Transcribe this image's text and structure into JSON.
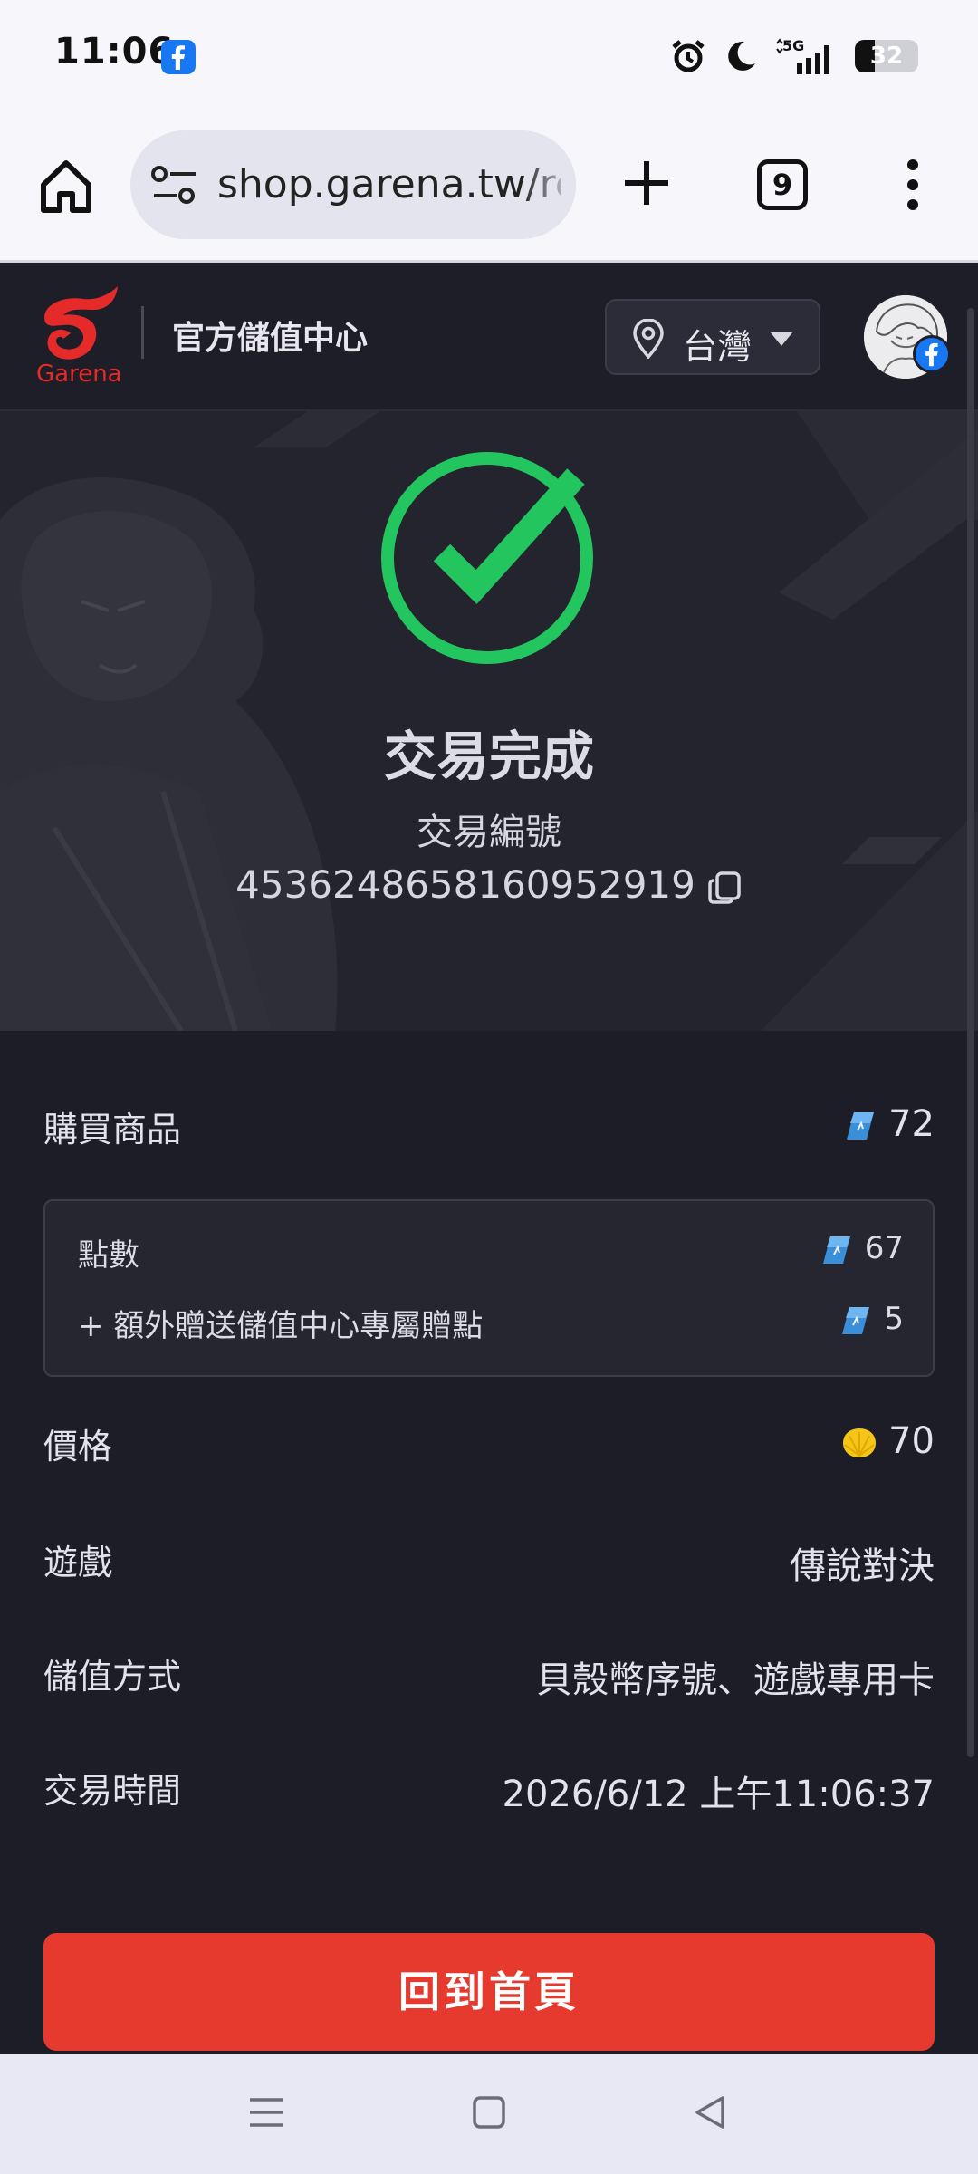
{
  "status_bar": {
    "time": "11:06",
    "network": "5G",
    "battery_percent": "32",
    "battery_level": 0.32,
    "icons": [
      "facebook-icon",
      "alarm-icon",
      "moon-icon",
      "signal-icon",
      "battery-icon"
    ]
  },
  "browser": {
    "url": "shop.garena.tw/re",
    "tab_count": "9",
    "icons": [
      "home-icon",
      "site-settings-icon",
      "plus-icon",
      "menu-dots-icon"
    ]
  },
  "header": {
    "logo_text": "Garena",
    "title": "官方儲值中心",
    "region": "台灣",
    "brand_color": "#e52a2a"
  },
  "hero": {
    "title": "交易完成",
    "order_label": "交易編號",
    "order_id": "4536248658160952919",
    "success_color": "#22c55e"
  },
  "details": {
    "purchase": {
      "label": "購買商品",
      "value": "72"
    },
    "breakdown": [
      {
        "label": "點數",
        "value": "67"
      },
      {
        "label": "+ 額外贈送儲值中心專屬贈點",
        "value": "5"
      }
    ],
    "price": {
      "label": "價格",
      "value": "70"
    },
    "game": {
      "label": "遊戲",
      "value": "傳說對決"
    },
    "method": {
      "label": "儲值方式",
      "value": "貝殼幣序號、遊戲專用卡"
    },
    "time": {
      "label": "交易時間",
      "value": "2026/6/12 上午11:06:37"
    }
  },
  "cta": {
    "label": "回到首頁",
    "color": "#e63a2e"
  }
}
